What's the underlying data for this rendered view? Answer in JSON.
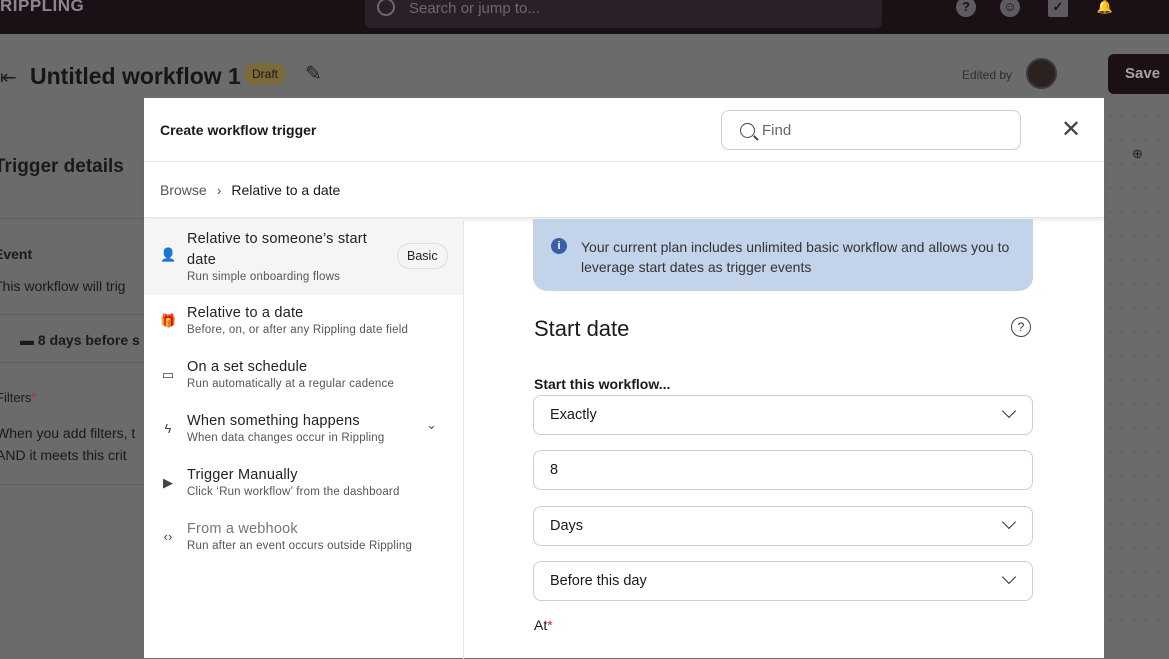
{
  "topbar": {
    "logo": "RIPPLING",
    "search_placeholder": "Search or jump to..."
  },
  "page": {
    "title": "Untitled workflow 1",
    "status": "Draft",
    "edited_by": "Edited by",
    "save": "Save",
    "section_title": "Trigger details",
    "event_label": "Event",
    "event_desc": "This workflow will trig",
    "event_value": "8 days before s",
    "filters_label": "Filters",
    "filters_desc_1": "When you add filters, t",
    "filters_desc_2": "AND it meets this crit"
  },
  "modal": {
    "title": "Create workflow trigger",
    "find_placeholder": "Find",
    "breadcrumb": [
      "Browse",
      "Relative to a date"
    ],
    "triggers": [
      {
        "title": "Relative to someone’s start date",
        "subtitle": "Run simple onboarding flows",
        "badge": "Basic",
        "icon": "person-add-icon"
      },
      {
        "title": "Relative to a date",
        "subtitle": "Before, on, or after any Rippling date field",
        "icon": "gift-icon"
      },
      {
        "title": "On a set schedule",
        "subtitle": "Run automatically at a regular cadence",
        "icon": "calendar-icon"
      },
      {
        "title": "When something happens",
        "subtitle": "When data changes occur in Rippling",
        "icon": "lightning-icon"
      },
      {
        "title": "Trigger Manually",
        "subtitle": "Click ‘Run workflow’ from the dashboard",
        "icon": "play-icon"
      },
      {
        "title": "From a webhook",
        "subtitle": "Run after an event occurs outside Rippling",
        "icon": "code-icon"
      }
    ],
    "info": "Your current plan includes unlimited basic workflow and allows you to leverage start dates as trigger events",
    "form_title": "Start date",
    "start_label": "Start this workflow...",
    "mode": "Exactly",
    "amount": "8",
    "unit": "Days",
    "relation": "Before this day",
    "at_label": "At"
  }
}
